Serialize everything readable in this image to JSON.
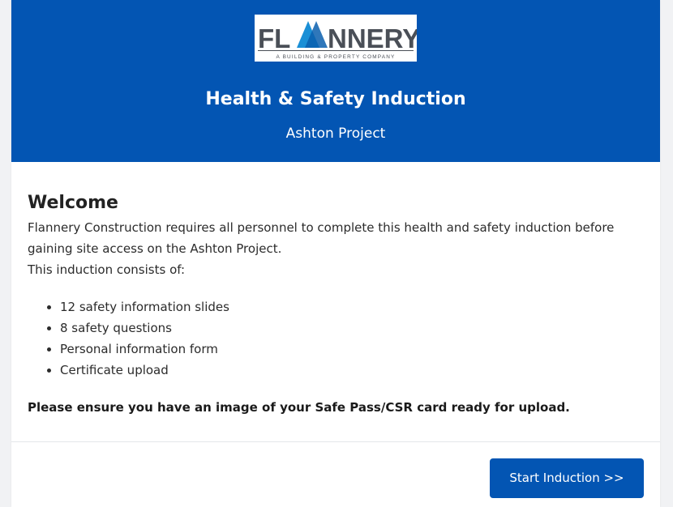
{
  "header": {
    "logo": {
      "brand_text": "FLANNERY",
      "tagline": "A BUILDING & PROPERTY COMPANY"
    },
    "title": "Health & Safety Induction",
    "subtitle": "Ashton Project"
  },
  "content": {
    "heading": "Welcome",
    "intro": "Flannery Construction requires all personnel to complete this health and safety induction before gaining site access on the Ashton Project.",
    "intro2": "This induction consists of:",
    "items": [
      "12 safety information slides",
      "8 safety questions",
      "Personal information form",
      "Certificate upload"
    ],
    "note": "Please ensure you have an image of your Safe Pass/CSR card ready for upload."
  },
  "footer": {
    "start_label": "Start Induction >>"
  },
  "colors": {
    "brand_blue": "#0355b3",
    "logo_gray": "#4a4f57",
    "logo_accent": "#1a8fd6"
  }
}
